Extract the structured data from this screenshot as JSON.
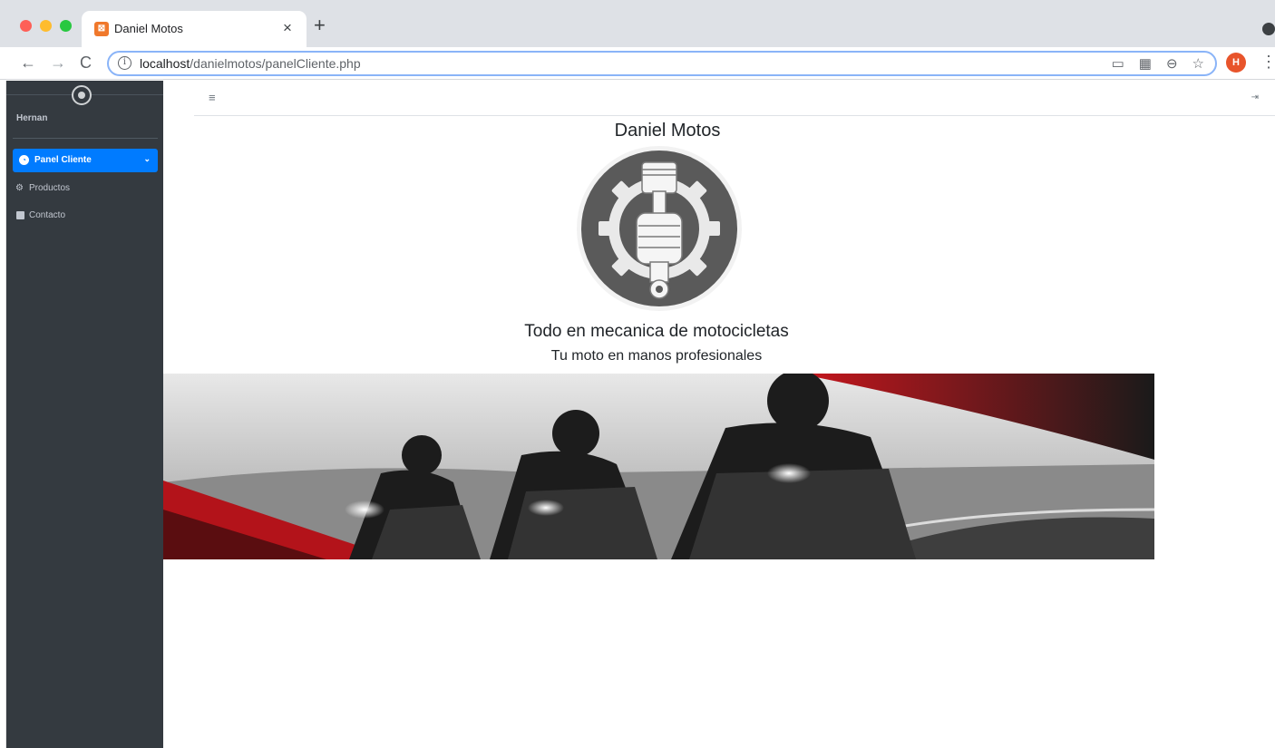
{
  "browser": {
    "tab_title": "Daniel Motos",
    "tab_close": "×",
    "new_tab": "+",
    "url_host": "localhost",
    "url_path": "/danielmotos/panelCliente.php",
    "profile_initial": "H",
    "icons": [
      "back-icon",
      "forward-icon",
      "reload-icon",
      "info-icon",
      "cast-icon",
      "qr-code-icon",
      "zoom-icon",
      "star-icon",
      "kebab-icon"
    ]
  },
  "sidebar": {
    "user_name": "Hernan",
    "items": [
      {
        "label": "Panel Cliente",
        "icon": "dashboard-icon",
        "active": true
      },
      {
        "label": "Productos",
        "icon": "motorcycle-icon",
        "active": false
      },
      {
        "label": "Contacto",
        "icon": "contact-card-icon",
        "active": false
      }
    ]
  },
  "topnav": {
    "menu_icon": "hamburger-icon",
    "logout_icon": "logout-icon"
  },
  "main": {
    "title": "Daniel Motos",
    "tagline": "Todo en mecanica de motocicletas",
    "subtagline": "Tu moto en manos profesionales"
  },
  "colors": {
    "sidebar_bg": "#343a40",
    "active_item": "#007bff",
    "logo_gray": "#5a5a5a",
    "banner_red": "#c8161d"
  }
}
